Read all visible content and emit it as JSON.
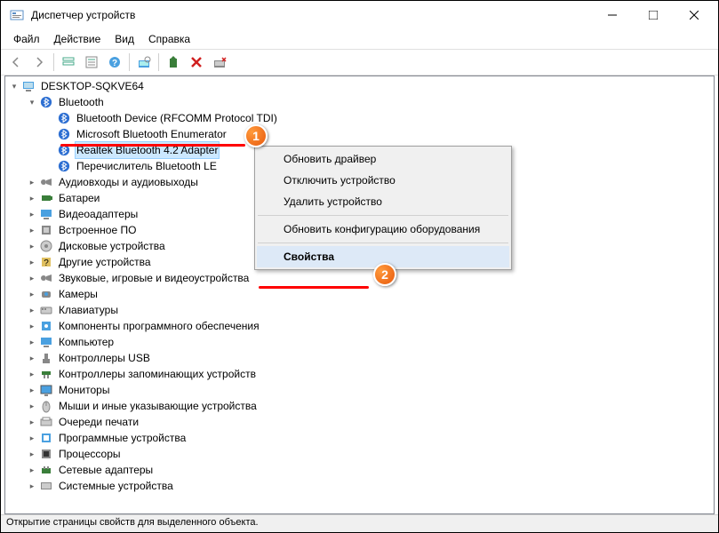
{
  "window": {
    "title": "Диспетчер устройств"
  },
  "menu": {
    "file": "Файл",
    "action": "Действие",
    "view": "Вид",
    "help": "Справка"
  },
  "tree": {
    "root": "DESKTOP-SQKVE64",
    "bluetooth": "Bluetooth",
    "bt_children": [
      "Bluetooth Device (RFCOMM Protocol TDI)",
      "Microsoft Bluetooth Enumerator",
      "Realtek Bluetooth 4.2 Adapter",
      "Перечислитель Bluetooth LE"
    ],
    "categories": [
      "Аудиовходы и аудиовыходы",
      "Батареи",
      "Видеоадаптеры",
      "Встроенное ПО",
      "Дисковые устройства",
      "Другие устройства",
      "Звуковые, игровые и видеоустройства",
      "Камеры",
      "Клавиатуры",
      "Компоненты программного обеспечения",
      "Компьютер",
      "Контроллеры USB",
      "Контроллеры запоминающих устройств",
      "Мониторы",
      "Мыши и иные указывающие устройства",
      "Очереди печати",
      "Программные устройства",
      "Процессоры",
      "Сетевые адаптеры",
      "Системные устройства"
    ]
  },
  "context_menu": {
    "update": "Обновить драйвер",
    "disable": "Отключить устройство",
    "uninstall": "Удалить устройство",
    "scan": "Обновить конфигурацию оборудования",
    "props": "Свойства"
  },
  "status": "Открытие страницы свойств для выделенного объекта.",
  "badges": {
    "one": "1",
    "two": "2"
  }
}
